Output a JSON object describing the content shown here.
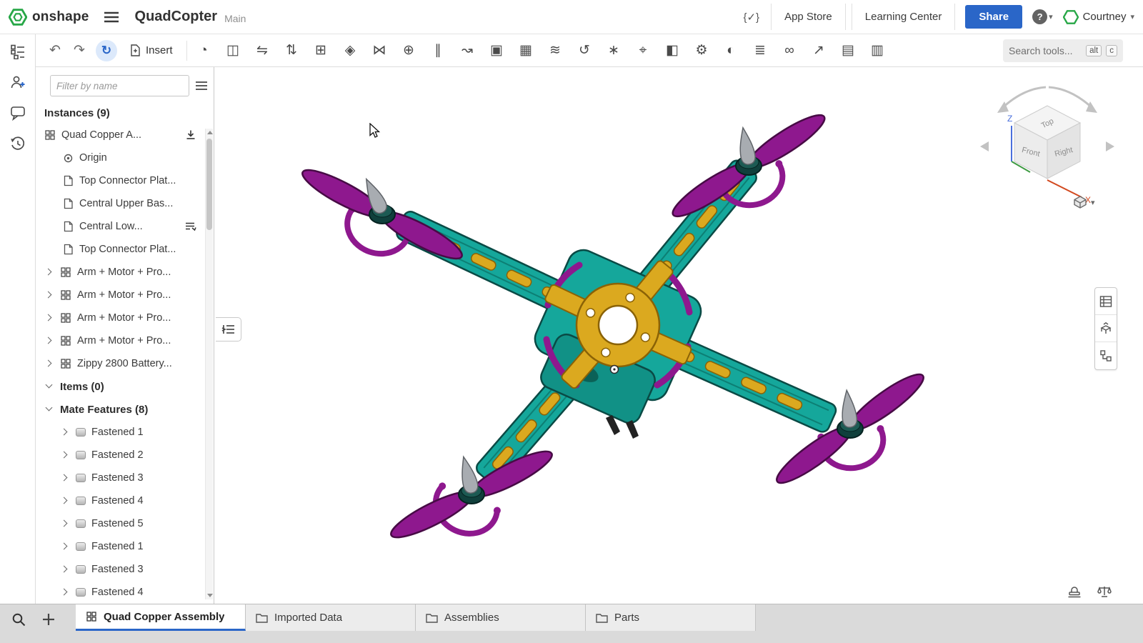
{
  "header": {
    "brand": "onshape",
    "title": "QuadCopter",
    "workspace": "Main",
    "version_icon_label": "{✓}",
    "app_store": "App Store",
    "learning_center": "Learning Center",
    "share": "Share",
    "help": "?",
    "user": "Courtney"
  },
  "colors": {
    "accent_blue": "#2a66c8",
    "brand_green": "#27a747",
    "frame_teal": "#15a79b",
    "accent_gold": "#dba91f",
    "propeller_magenta": "#8e188e"
  },
  "toolbar": {
    "insert": "Insert",
    "search_placeholder": "Search tools...",
    "shortcut_alt": "alt",
    "shortcut_key": "c",
    "icons": [
      {
        "name": "mate-icon",
        "glyph": "◔"
      },
      {
        "name": "mate-connector-icon",
        "glyph": "◫"
      },
      {
        "name": "revolute-mate-icon",
        "glyph": "⇋"
      },
      {
        "name": "slider-mate-icon",
        "glyph": "⇅"
      },
      {
        "name": "planar-mate-icon",
        "glyph": "⊞"
      },
      {
        "name": "cylindrical-mate-icon",
        "glyph": "◈"
      },
      {
        "name": "pin-slot-mate-icon",
        "glyph": "⋈"
      },
      {
        "name": "ball-mate-icon",
        "glyph": "⊕"
      },
      {
        "name": "parallel-mate-icon",
        "glyph": "∥"
      },
      {
        "name": "tangent-mate-icon",
        "glyph": "↝"
      },
      {
        "name": "group-icon",
        "glyph": "▣"
      },
      {
        "name": "insert-feature-icon",
        "glyph": "▦"
      },
      {
        "name": "linear-pattern-icon",
        "glyph": "≋"
      },
      {
        "name": "circular-pattern-icon",
        "glyph": "↺"
      },
      {
        "name": "replicate-icon",
        "glyph": "∗"
      },
      {
        "name": "snap-mode-icon",
        "glyph": "⌖"
      },
      {
        "name": "section-view-icon",
        "glyph": "◧"
      },
      {
        "name": "gear-relation-icon",
        "glyph": "⚙"
      },
      {
        "name": "cam-relation-icon",
        "glyph": "◐"
      },
      {
        "name": "screw-relation-icon",
        "glyph": "≣"
      },
      {
        "name": "belt-relation-icon",
        "glyph": "∞"
      },
      {
        "name": "exploded-view-icon",
        "glyph": "↗"
      },
      {
        "name": "named-positions-icon",
        "glyph": "▤"
      },
      {
        "name": "bom-icon",
        "glyph": "▥"
      }
    ]
  },
  "left_panel": {
    "filter_placeholder": "Filter by name",
    "instances_header": "Instances (9)",
    "items_header": "Items (0)",
    "mates_header": "Mate Features (8)",
    "instances": [
      {
        "label": "Quad Copper A..."
      },
      {
        "label": "Origin"
      },
      {
        "label": "Top Connector Plat..."
      },
      {
        "label": "Central Upper Bas..."
      },
      {
        "label": "Central Low..."
      },
      {
        "label": "Top Connector Plat..."
      },
      {
        "label": "Arm + Motor + Pro..."
      },
      {
        "label": "Arm + Motor + Pro..."
      },
      {
        "label": "Arm + Motor + Pro..."
      },
      {
        "label": "Arm + Motor + Pro..."
      },
      {
        "label": "Zippy 2800 Battery..."
      }
    ],
    "mates": [
      "Fastened 1",
      "Fastened 2",
      "Fastened 3",
      "Fastened 4",
      "Fastened 5",
      "Fastened 1",
      "Fastened 3",
      "Fastened 4"
    ]
  },
  "viewcube": {
    "top": "Top",
    "front": "Front",
    "right": "Right",
    "z": "Z",
    "x": "X"
  },
  "tabs": [
    {
      "label": "Quad Copper Assembly"
    },
    {
      "label": "Imported Data"
    },
    {
      "label": "Assemblies"
    },
    {
      "label": "Parts"
    }
  ]
}
